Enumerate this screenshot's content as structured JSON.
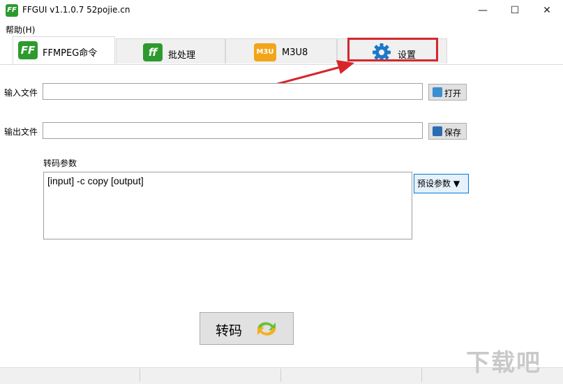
{
  "window": {
    "icon_text": "FF",
    "title": "FFGUI v1.1.0.7    52pojie.cn",
    "minimize": "—",
    "maximize": "☐",
    "close": "✕"
  },
  "menu": {
    "help": "帮助(H)"
  },
  "tabs": [
    {
      "label": "FFMPEG命令",
      "icon_text": "FF",
      "active": true
    },
    {
      "label": "批处理",
      "icon_text": "ff",
      "active": false
    },
    {
      "label": "M3U8",
      "icon_text": "M3U",
      "active": false
    },
    {
      "label": "设置",
      "icon_text": "⚙",
      "active": false
    }
  ],
  "form": {
    "input_label": "输入文件",
    "input_value": "",
    "open_button": "打开",
    "output_label": "输出文件",
    "output_value": "",
    "save_button": "保存",
    "params_label": "转码参数",
    "params_value": "[input] -c copy [output]",
    "preset_button": "预设参数 ▼",
    "convert_button": "转码"
  },
  "watermark": "下载吧",
  "colors": {
    "highlight": "#d6262b",
    "arrow": "#d6262b",
    "ff_green": "#2e9a2e",
    "m3u_orange": "#f2a51a",
    "gear_blue": "#1e78c8"
  }
}
